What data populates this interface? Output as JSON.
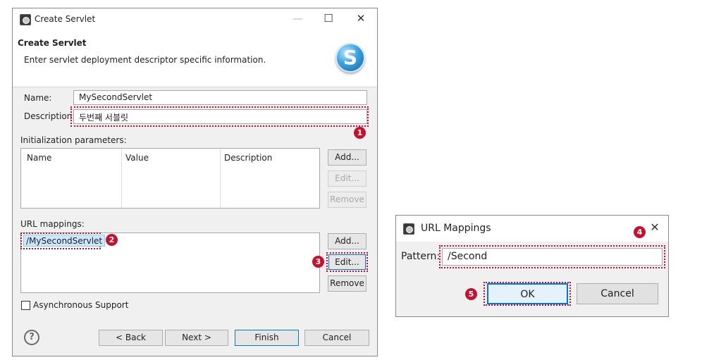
{
  "main_dialog": {
    "title": "Create Servlet",
    "banner_title": "Create Servlet",
    "banner_subtitle": "Enter servlet deployment descriptor specific information.",
    "name_label": "Name:",
    "name_value": "MySecondServlet",
    "description_label": "Description:",
    "description_value": "두번째 서블릿",
    "init_params_label": "Initialization parameters:",
    "init_params_columns": [
      "Name",
      "Value",
      "Description"
    ],
    "init_add": "Add...",
    "init_edit": "Edit...",
    "init_remove": "Remove",
    "url_mappings_label": "URL mappings:",
    "url_mappings_items": [
      "/MySecondServlet"
    ],
    "url_add": "Add...",
    "url_edit": "Edit...",
    "url_remove": "Remove",
    "async_label": "Asynchronous Support",
    "async_checked": false,
    "help": "?",
    "back": "< Back",
    "next": "Next >",
    "finish": "Finish",
    "cancel": "Cancel",
    "minimize": "—",
    "maximize": "☐",
    "close": "✕"
  },
  "url_dialog": {
    "title": "URL Mappings",
    "close": "✕",
    "pattern_label": "Pattern:",
    "pattern_value": "/Second",
    "ok": "OK",
    "cancel": "Cancel"
  },
  "badges": [
    "1",
    "2",
    "3",
    "4",
    "5"
  ],
  "colors": {
    "annotation_red": "#c8102e",
    "selection_blue": "#cce8ff",
    "focus_blue": "#0078d7",
    "logo_blue": "#3aa3e0"
  },
  "icons": {
    "app": "eclipse-servlet-icon",
    "logo": "servlet-s-logo-icon",
    "help": "help-question-icon"
  }
}
